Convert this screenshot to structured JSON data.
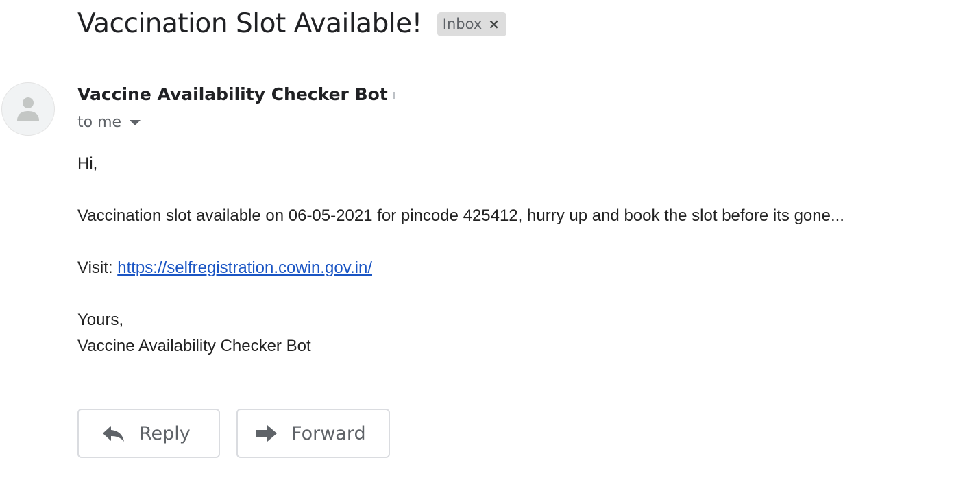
{
  "email": {
    "subject": "Vaccination Slot Available!",
    "label": "Inbox",
    "label_remove": "×",
    "sender_name": "Vaccine Availability Checker Bot",
    "recipient": "to me",
    "body": {
      "greeting": "Hi,",
      "message": "Vaccination slot available on 06-05-2021 for pincode 425412, hurry up and book the slot before its gone...",
      "visit_prefix": "Visit: ",
      "link": "https://selfregistration.cowin.gov.in/",
      "closing": "Yours,",
      "signature": "Vaccine Availability Checker Bot"
    }
  },
  "actions": {
    "reply_label": "Reply",
    "forward_label": "Forward"
  },
  "icons": {
    "avatar": "person-icon",
    "recipient_details": "caret-down-icon",
    "reply": "reply-arrow-icon",
    "forward": "forward-arrow-icon"
  },
  "colors": {
    "link": "#1a55c4",
    "chip_background": "#dddddd",
    "muted_text": "#5f6368"
  }
}
